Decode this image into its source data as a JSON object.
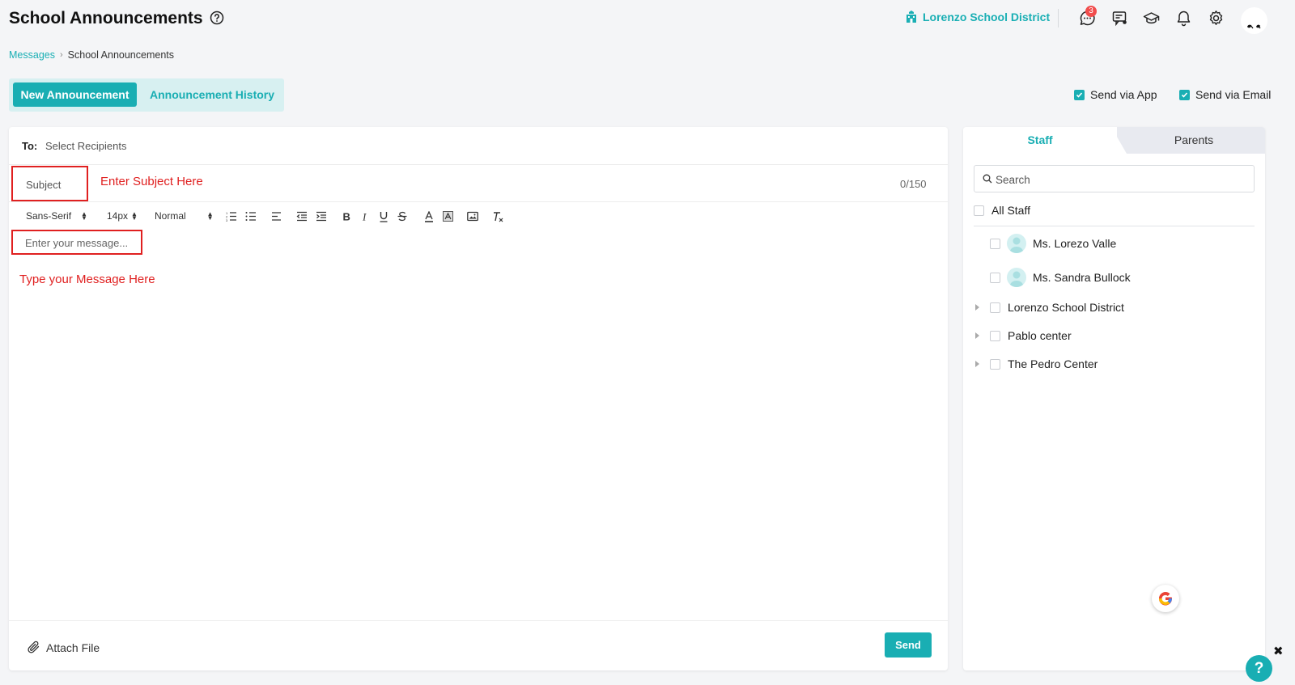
{
  "header": {
    "title": "School Announcements",
    "district": "Lorenzo School District",
    "notification_count": "3"
  },
  "breadcrumb": {
    "parent": "Messages",
    "current": "School Announcements"
  },
  "tabs": {
    "new": "New Announcement",
    "history": "Announcement History"
  },
  "send_options": {
    "app": "Send via App",
    "email": "Send via Email"
  },
  "compose": {
    "to_label": "To:",
    "to_value": "Select Recipients",
    "subject_placeholder": "Subject",
    "subject_hint": "Enter Subject Here",
    "char_count": "0/150",
    "message_placeholder": "Enter your message...",
    "message_hint": "Type your Message Here",
    "attach_label": "Attach File",
    "send_label": "Send"
  },
  "toolbar": {
    "font": "Sans-Serif",
    "size": "14px",
    "heading": "Normal"
  },
  "recipients": {
    "tabs": [
      "Staff",
      "Parents"
    ],
    "search_placeholder": "Search",
    "all_label": "All Staff",
    "staff": [
      "Ms. Lorezo Valle",
      "Ms. Sandra Bullock"
    ],
    "groups": [
      "Lorenzo School District",
      "Pablo center",
      "The Pedro Center"
    ]
  },
  "help_fab": "?",
  "colors": {
    "accent": "#19aeb3",
    "tab_bg": "#d7f0f1",
    "annotation": "#e02020",
    "badge": "#f14d4d"
  }
}
